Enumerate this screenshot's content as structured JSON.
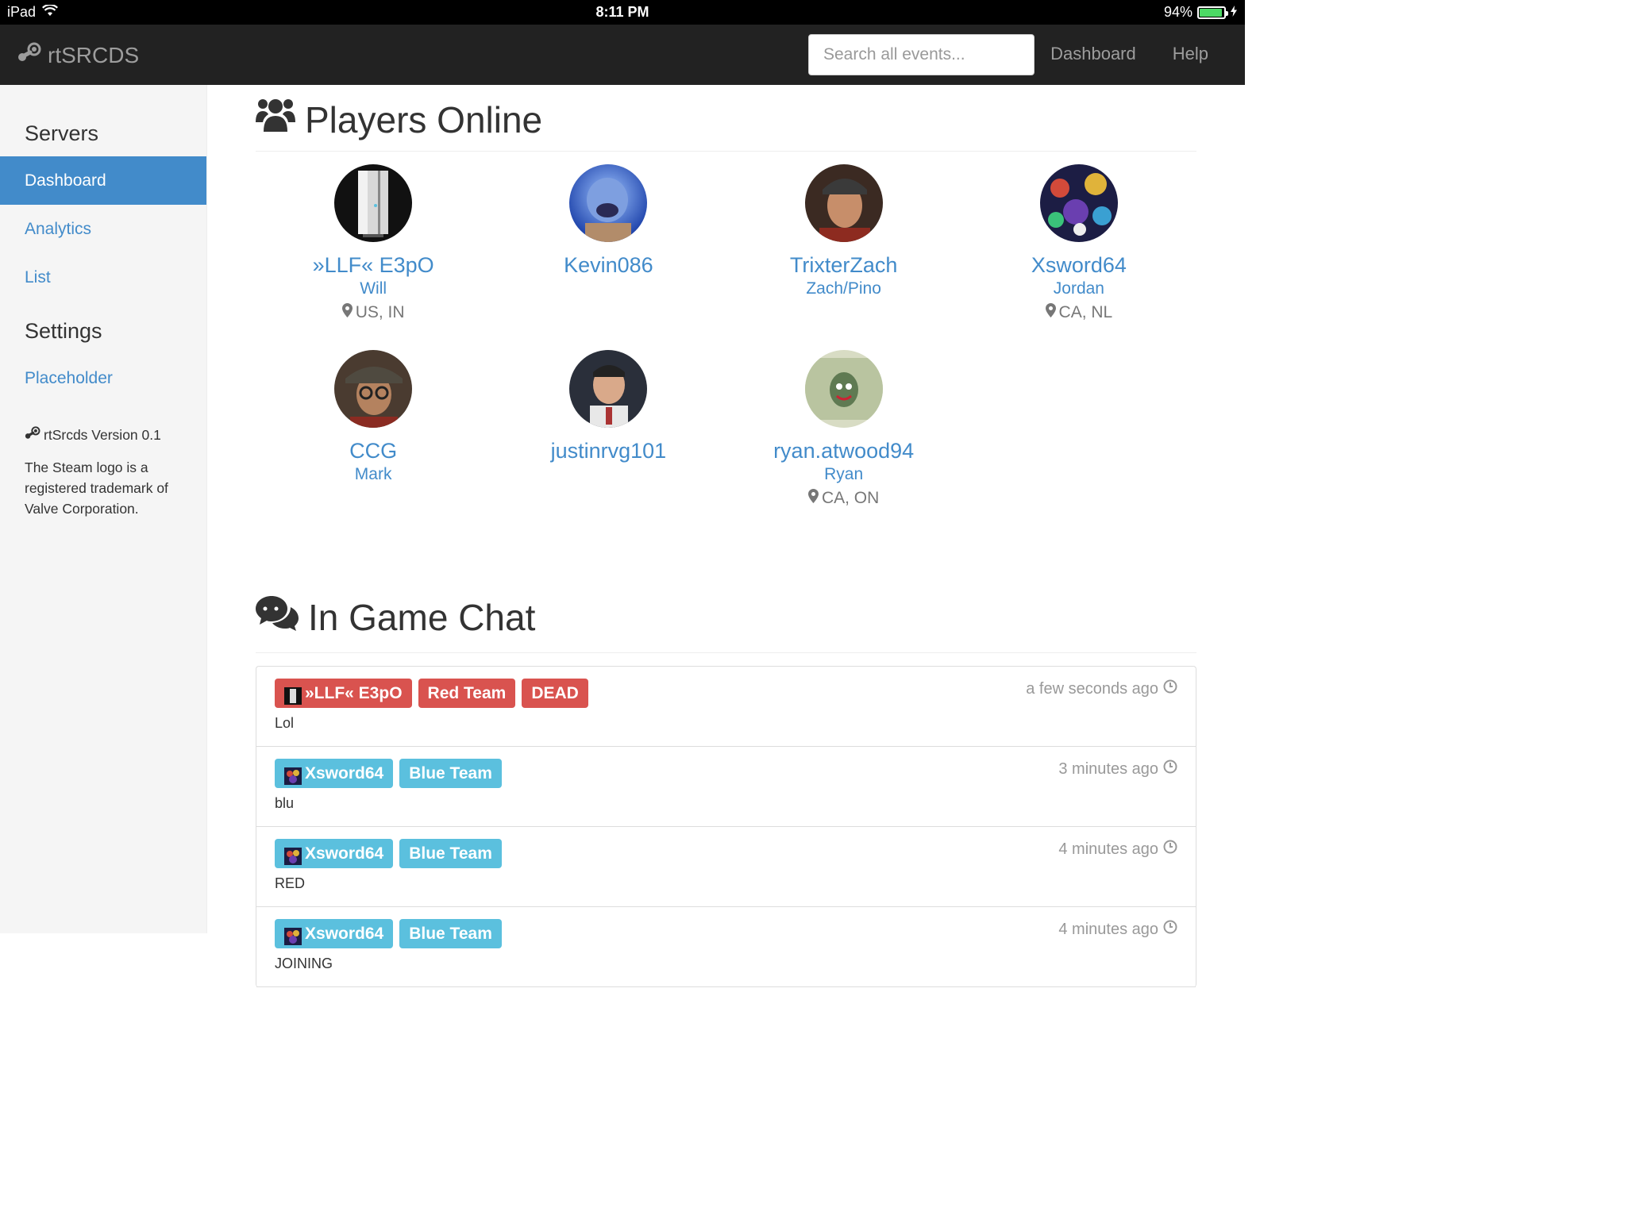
{
  "status_bar": {
    "device": "iPad",
    "time": "8:11 PM",
    "battery": "94%",
    "battery_level": 0.94
  },
  "navbar": {
    "brand": "rtSRCDS",
    "search_placeholder": "Search all events...",
    "links": [
      "Dashboard",
      "Help"
    ]
  },
  "sidebar": {
    "servers_heading": "Servers",
    "items": [
      "Dashboard",
      "Analytics",
      "List"
    ],
    "settings_heading": "Settings",
    "settings_items": [
      "Placeholder"
    ],
    "version": "rtSrcds Version 0.1",
    "trademark": "The Steam logo is a registered trademark of Valve Corporation."
  },
  "players_section": {
    "title": "Players Online",
    "players": [
      {
        "name": "»LLF« E3pO",
        "real": "Will",
        "location": "US, IN",
        "avatar": "server-tower"
      },
      {
        "name": "Kevin086",
        "real": "",
        "location": "",
        "avatar": "heavy"
      },
      {
        "name": "TrixterZach",
        "real": "Zach/Pino",
        "location": "",
        "avatar": "scout"
      },
      {
        "name": "Xsword64",
        "real": "Jordan",
        "location": "CA, NL",
        "avatar": "collage"
      },
      {
        "name": "CCG",
        "real": "Mark",
        "location": "",
        "avatar": "spy"
      },
      {
        "name": "justinrvg101",
        "real": "",
        "location": "",
        "avatar": "medic"
      },
      {
        "name": "ryan.atwood94",
        "real": "Ryan",
        "location": "CA, ON",
        "avatar": "dollar"
      }
    ]
  },
  "chat_section": {
    "title": "In Game Chat",
    "messages": [
      {
        "player": "»LLF« E3pO",
        "team": "Red Team",
        "dead": "DEAD",
        "color": "red",
        "text": "Lol",
        "time": "a few seconds ago"
      },
      {
        "player": "Xsword64",
        "team": "Blue Team",
        "dead": "",
        "color": "blue",
        "text": "blu",
        "time": "3 minutes ago"
      },
      {
        "player": "Xsword64",
        "team": "Blue Team",
        "dead": "",
        "color": "blue",
        "text": "RED",
        "time": "4 minutes ago"
      },
      {
        "player": "Xsword64",
        "team": "Blue Team",
        "dead": "",
        "color": "blue",
        "text": "JOINING",
        "time": "4 minutes ago"
      }
    ]
  },
  "colors": {
    "primary": "#428bca",
    "danger": "#d9534f",
    "info": "#5bc0de",
    "navbar": "#222222"
  }
}
